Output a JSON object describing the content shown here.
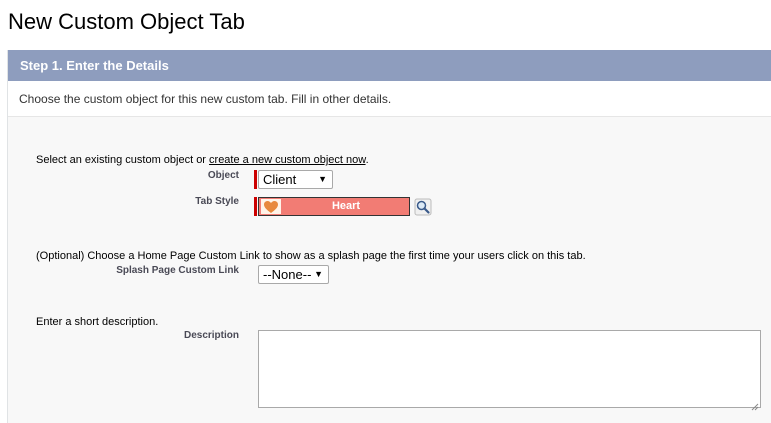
{
  "page": {
    "title": "New Custom Object Tab"
  },
  "step": {
    "header": "Step 1. Enter the Details",
    "intro": "Choose the custom object for this new custom tab. Fill in other details."
  },
  "object_section": {
    "instruction_prefix": "Select an existing custom object or ",
    "link_text": "create a new custom object now",
    "instruction_suffix": ".",
    "object_label": "Object",
    "object_value": "Client",
    "tab_style_label": "Tab Style",
    "tab_style_value": "Heart"
  },
  "splash_section": {
    "instruction": "(Optional) Choose a Home Page Custom Link to show as a splash page the first time your users click on this tab.",
    "label": "Splash Page Custom Link",
    "value": "--None--"
  },
  "description_section": {
    "instruction": "Enter a short description.",
    "label": "Description",
    "value": ""
  },
  "icons": {
    "dropdown": "triangle-down",
    "lookup": "magnifier",
    "tab_style": "heart",
    "required": "red-bar"
  },
  "colors": {
    "header_bg": "#8e9dbe",
    "tab_style_bg": "#f27c74",
    "required": "#cc0000"
  }
}
